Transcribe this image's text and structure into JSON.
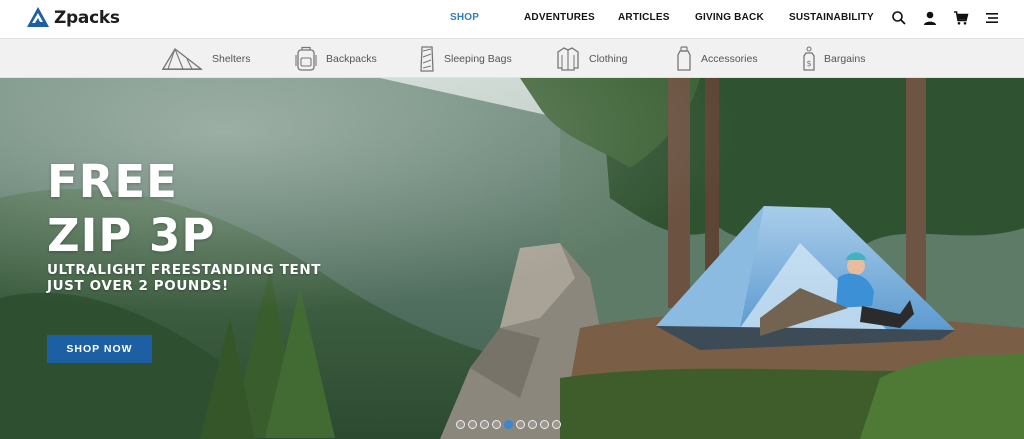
{
  "brand": {
    "name": "Zpacks",
    "color": "#1d5fa3"
  },
  "nav": {
    "items": [
      {
        "label": "SHOP",
        "active": true
      },
      {
        "label": "ADVENTURES"
      },
      {
        "label": "ARTICLES"
      },
      {
        "label": "GIVING BACK"
      },
      {
        "label": "SUSTAINABILITY"
      }
    ],
    "active_color": "#2e7fc4",
    "icons": [
      "search-icon",
      "account-icon",
      "cart-icon",
      "menu-icon"
    ]
  },
  "categories": [
    {
      "label": "Shelters",
      "icon": "tent-icon"
    },
    {
      "label": "Backpacks",
      "icon": "backpack-icon"
    },
    {
      "label": "Sleeping Bags",
      "icon": "sleeping-bag-icon"
    },
    {
      "label": "Clothing",
      "icon": "jacket-icon"
    },
    {
      "label": "Accessories",
      "icon": "bottle-icon"
    },
    {
      "label": "Bargains",
      "icon": "price-tag-icon"
    }
  ],
  "hero": {
    "title_line1": "FREE",
    "title_line2": "ZIP 3P",
    "subtitle_line1": "ULTRALIGHT FREESTANDING TENT",
    "subtitle_line2": "JUST OVER 2 POUNDS!",
    "cta_label": "SHOP NOW",
    "cta_color": "#1d5fa3",
    "slides_total": 9,
    "active_slide": 4
  }
}
